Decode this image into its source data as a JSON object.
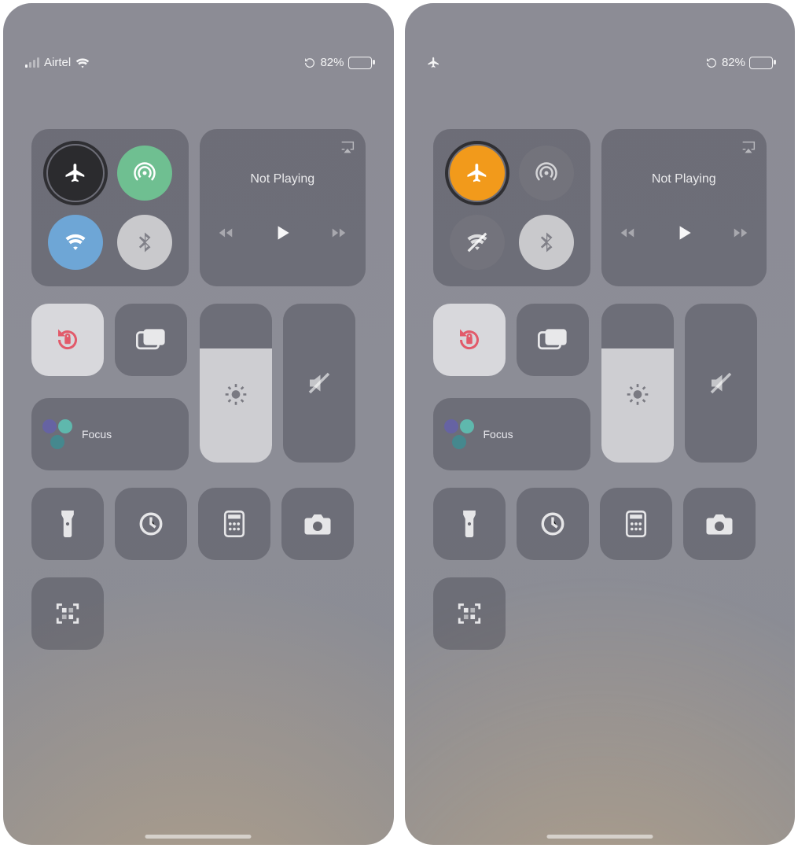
{
  "screens": [
    {
      "status": {
        "signal_bars_active": 1,
        "carrier": "Airtel",
        "wifi": true,
        "airplane_indicator": false,
        "battery_percent": "82%",
        "battery_fill_pct": 82
      },
      "connectivity": {
        "airplane": {
          "active": false,
          "bg": "#2b2b2e",
          "highlight_ring": true
        },
        "cellular": {
          "active": true,
          "bg": "#6fbf91"
        },
        "wifi": {
          "active": true,
          "bg": "#6ea6d6"
        },
        "bluetooth": {
          "active": false,
          "bg": "#c9c9cc"
        }
      },
      "media": {
        "now_playing": "Not Playing"
      },
      "rotation_lock_active": true,
      "focus_label": "Focus",
      "brightness_pct": 72,
      "volume_pct": 0
    },
    {
      "status": {
        "signal_bars_active": 0,
        "carrier": "",
        "wifi": false,
        "airplane_indicator": true,
        "battery_percent": "82%",
        "battery_fill_pct": 82
      },
      "connectivity": {
        "airplane": {
          "active": true,
          "bg": "#f29a1b",
          "highlight_ring": true
        },
        "cellular": {
          "active": false,
          "bg": "rgba(120,120,128,.55)"
        },
        "wifi": {
          "active": false,
          "bg": "rgba(120,120,128,.55)",
          "disabled": true
        },
        "bluetooth": {
          "active": false,
          "bg": "#c9c9cc"
        }
      },
      "media": {
        "now_playing": "Not Playing"
      },
      "rotation_lock_active": true,
      "focus_label": "Focus",
      "brightness_pct": 72,
      "volume_pct": 0
    }
  ],
  "icons": {
    "airplane": "airplane-icon",
    "cellular": "antenna-icon",
    "wifi": "wifi-icon",
    "wifi_off": "wifi-off-icon",
    "bluetooth": "bluetooth-icon",
    "rotation_lock": "rotation-lock-icon",
    "screen_mirror": "screen-mirror-icon",
    "brightness": "sun-icon",
    "volume_mute": "speaker-mute-icon",
    "flashlight": "flashlight-icon",
    "timer": "timer-icon",
    "calculator": "calculator-icon",
    "camera": "camera-icon",
    "qr": "qr-scanner-icon",
    "airplay": "airplay-icon",
    "play": "play-icon",
    "forward": "forward-icon",
    "rewind": "rewind-icon"
  }
}
